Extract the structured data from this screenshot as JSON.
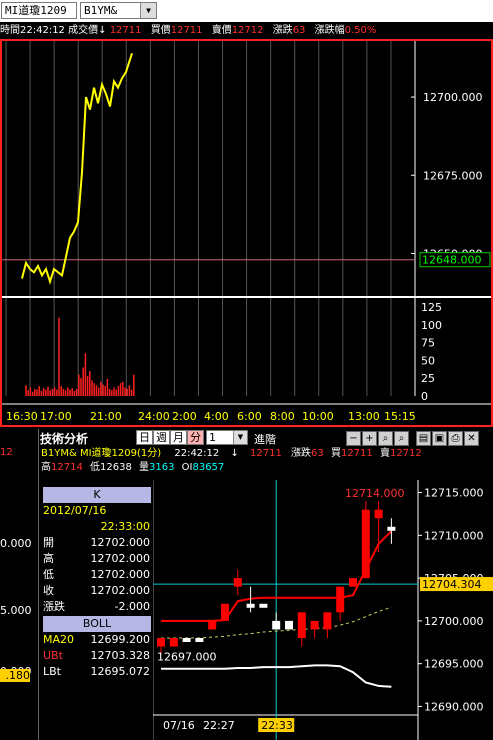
{
  "toolbar": {
    "symbol": "MI道瓊1209",
    "code": "B1YM&"
  },
  "quote": {
    "time_label": "時間",
    "time": "22:42:12",
    "last_label": "成交價↓",
    "last": "12711",
    "bid_label": "買價",
    "bid": "12711",
    "ask_label": "賣價",
    "ask": "12712",
    "chg_label": "漲跌",
    "chg": "63",
    "pct_label": "漲跌幅",
    "pct": "0.50%"
  },
  "chart_data": [
    {
      "type": "line",
      "title": "",
      "ylim": [
        12638,
        12716
      ],
      "y_ticks": [
        "12700.000",
        "12675.000",
        "12650.000"
      ],
      "reference_value": "12648.000",
      "reference": 12648,
      "x_ticks": [
        "16:30",
        "17:00",
        "21:00",
        "24:00",
        "2:00",
        "4:00",
        "6:00",
        "8:00",
        "10:00",
        "13:00",
        "15:15"
      ],
      "series": [
        {
          "x": [
            0,
            4,
            8,
            12,
            16,
            20,
            24,
            28,
            32,
            36,
            40,
            44,
            48,
            52,
            56,
            60,
            64,
            68,
            72,
            76,
            80,
            84,
            88,
            92,
            96,
            100,
            104,
            108,
            110
          ],
          "y": [
            12642,
            12647,
            12645,
            12644,
            12646,
            12643,
            12645,
            12641,
            12645,
            12644,
            12643,
            12649,
            12655,
            12657,
            12660,
            12676,
            12700,
            12696,
            12703,
            12698,
            12704,
            12701,
            12697,
            12705,
            12703,
            12706,
            12708,
            12712,
            12714
          ]
        }
      ]
    },
    {
      "type": "bar",
      "title": "",
      "ylim": [
        0,
        125
      ],
      "y_ticks": [
        "125",
        "100",
        "75",
        "50",
        "25",
        "0"
      ],
      "values": [
        15,
        8,
        12,
        6,
        10,
        9,
        14,
        7,
        11,
        9,
        13,
        8,
        10,
        12,
        9,
        110,
        14,
        10,
        8,
        12,
        9,
        11,
        7,
        10,
        30,
        25,
        40,
        60,
        28,
        35,
        22,
        18,
        15,
        12,
        20,
        16,
        14,
        24,
        10,
        8,
        12,
        9,
        14,
        18,
        20,
        12,
        10,
        15,
        9,
        30
      ]
    },
    {
      "type": "candlestick",
      "title": "",
      "ylim": [
        12689,
        12716
      ],
      "y_ticks": [
        "12715.000",
        "12710.000",
        "12705.000",
        "12700.000",
        "12695.000",
        "12690.000"
      ],
      "current_value": "12704.304",
      "annot_high": "12714.000",
      "annot_low": "12697.000",
      "x_ticks": [
        "07/16",
        "22:27",
        "22:33"
      ],
      "candles": [
        {
          "o": 12697,
          "c": 12698,
          "h": 12698,
          "l": 12696
        },
        {
          "o": 12697,
          "c": 12698,
          "h": 12698,
          "l": 12697
        },
        {
          "o": 12698,
          "c": 12698,
          "h": 12698,
          "l": 12698
        },
        {
          "o": 12698,
          "c": 12698,
          "h": 12698,
          "l": 12698
        },
        {
          "o": 12699,
          "c": 12700,
          "h": 12700,
          "l": 12699
        },
        {
          "o": 12700,
          "c": 12702,
          "h": 12702,
          "l": 12700
        },
        {
          "o": 12704,
          "c": 12705,
          "h": 12706,
          "l": 12703
        },
        {
          "o": 12702,
          "c": 12702,
          "h": 12704,
          "l": 12701
        },
        {
          "o": 12702,
          "c": 12702,
          "h": 12702,
          "l": 12702
        },
        {
          "o": 12700,
          "c": 12699,
          "h": 12701,
          "l": 12699
        },
        {
          "o": 12700,
          "c": 12699,
          "h": 12700,
          "l": 12699
        },
        {
          "o": 12698,
          "c": 12701,
          "h": 12701,
          "l": 12697
        },
        {
          "o": 12699,
          "c": 12700,
          "h": 12700,
          "l": 12698
        },
        {
          "o": 12699,
          "c": 12701,
          "h": 12701,
          "l": 12698
        },
        {
          "o": 12701,
          "c": 12704,
          "h": 12704,
          "l": 12700
        },
        {
          "o": 12704,
          "c": 12705,
          "h": 12705,
          "l": 12704
        },
        {
          "o": 12705,
          "c": 12713,
          "h": 12714,
          "l": 12705
        },
        {
          "o": 12712,
          "c": 12713,
          "h": 12714,
          "l": 12708
        },
        {
          "o": 12711,
          "c": 12711,
          "h": 12712,
          "l": 12709
        }
      ],
      "ma20": [
        12698.0,
        12698.0,
        12698.0,
        12698.0,
        12698.1,
        12698.2,
        12698.4,
        12698.5,
        12698.7,
        12698.8,
        12698.9,
        12699.0,
        12699.1,
        12699.2,
        12699.5,
        12699.9,
        12700.5,
        12701.1,
        12701.6
      ],
      "upper": [
        12700.0,
        12700.0,
        12700.0,
        12700.0,
        12700.0,
        12700.1,
        12702.3,
        12702.6,
        12702.7,
        12702.7,
        12702.7,
        12702.7,
        12702.7,
        12702.7,
        12702.7,
        12703.0,
        12706.0,
        12709.0,
        12710.5
      ],
      "lower": [
        12694.4,
        12694.4,
        12694.4,
        12694.4,
        12694.4,
        12694.4,
        12694.5,
        12694.5,
        12694.6,
        12694.6,
        12694.6,
        12694.7,
        12694.8,
        12694.8,
        12694.7,
        12694.0,
        12692.8,
        12692.4,
        12692.3
      ]
    }
  ],
  "tech": {
    "title": "技術分析",
    "btn_day": "日",
    "btn_week": "週",
    "btn_month": "月",
    "btn_minute": "分",
    "period": "1",
    "advanced": "進階",
    "line2_code": "B1YM&",
    "line2_symbol": "MI道瓊1209(1分)",
    "line2_time": "22:42:12",
    "line2_arrow": "↓",
    "line2_last": "12711",
    "line2_chg_label": "漲跌",
    "line2_chg": "63",
    "line2_bid_label": "買",
    "line2_bid": "12711",
    "line2_ask_label": "賣",
    "line2_ask": "12712",
    "line3_high_label": "高",
    "line3_high": "12714",
    "line3_low_label": "低",
    "line3_low": "12638",
    "line3_vol_label": "量",
    "line3_vol": "3163",
    "line3_oi_label": "OI",
    "line3_oi": "83657"
  },
  "k_panel": {
    "header": "K",
    "date": "2012/07/16",
    "time": "22:33:00",
    "rows": [
      {
        "k": "開",
        "v": "12702.000"
      },
      {
        "k": "高",
        "v": "12702.000"
      },
      {
        "k": "低",
        "v": "12702.000"
      },
      {
        "k": "收",
        "v": "12702.000"
      },
      {
        "k": "漲跌",
        "v": "-2.000"
      }
    ]
  },
  "boll_panel": {
    "header": "BOLL",
    "rows": [
      {
        "k": "MA20",
        "v": "12699.200"
      },
      {
        "k": "UBt",
        "v": "12703.328"
      },
      {
        "k": "LBt",
        "v": "12695.072"
      }
    ]
  },
  "left_partial": {
    "v1": "12",
    "v2": "0.000",
    "v3": "5.000",
    "v4": "0.000",
    "v5": ".180"
  },
  "colors": {
    "price_line": "#ffff00",
    "up_candle": "#ff0000",
    "down_candle": "#ffffff",
    "upper_band": "#ff0000",
    "ma20": "#cccc66",
    "lower_band": "#ffffff",
    "cursor": "#00cccc"
  }
}
